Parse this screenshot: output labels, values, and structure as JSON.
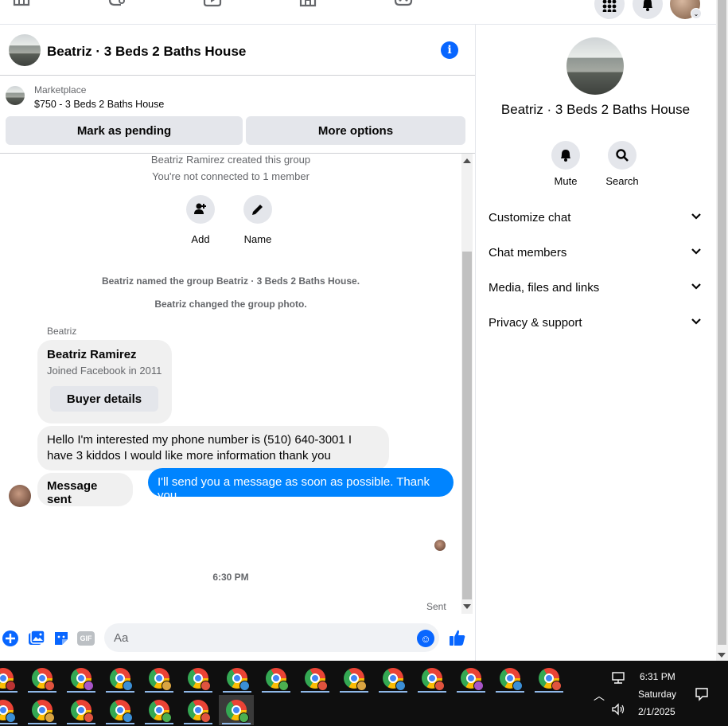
{
  "chat": {
    "title": "Beatriz · 3 Beds 2 Baths House",
    "marketplace_label": "Marketplace",
    "listing": "$750 - 3 Beds 2 Baths House",
    "mark_pending": "Mark as pending",
    "more_options": "More options"
  },
  "messages": {
    "created": "Beatriz Ramirez created this group",
    "not_connected": "You're not connected to 1 member",
    "add_label": "Add",
    "name_label": "Name",
    "named_event": "Beatriz named the group Beatriz · 3 Beds 2 Baths House.",
    "photo_event": "Beatriz changed the group photo.",
    "sender": "Beatriz",
    "card_name": "Beatriz Ramirez",
    "card_joined": "Joined Facebook in 2011",
    "buyer_details": "Buyer details",
    "msg1": "Hello I'm interested my phone number is (510) 640-3001 I have 3 kiddos I would like more information thank you",
    "msg2": "Message sent",
    "time": "6:30 PM",
    "outgoing": "I'll send you a message as soon as possible. Thank you",
    "status": "Sent"
  },
  "composer": {
    "placeholder": "Aa",
    "gif_label": "GIF"
  },
  "right_panel": {
    "title": "Beatriz · 3 Beds 2 Baths House",
    "mute": "Mute",
    "search": "Search",
    "sections": [
      "Customize chat",
      "Chat members",
      "Media, files and links",
      "Privacy & support"
    ]
  },
  "taskbar": {
    "time": "6:31 PM",
    "day": "Saturday",
    "date": "2/1/2025",
    "badge_colors": [
      "#e0533e",
      "#a855c8",
      "#3b8fd6",
      "#d9a441",
      "#e0533e",
      "#3b8fd6",
      "#4caf50",
      "#e0533e",
      "#d9a441",
      "#3b8fd6",
      "#e0533e",
      "#a855c8",
      "#3b8fd6",
      "#e0533e"
    ]
  },
  "colors": {
    "accent": "#0866ff",
    "outgoing_bubble": "#0084ff"
  }
}
